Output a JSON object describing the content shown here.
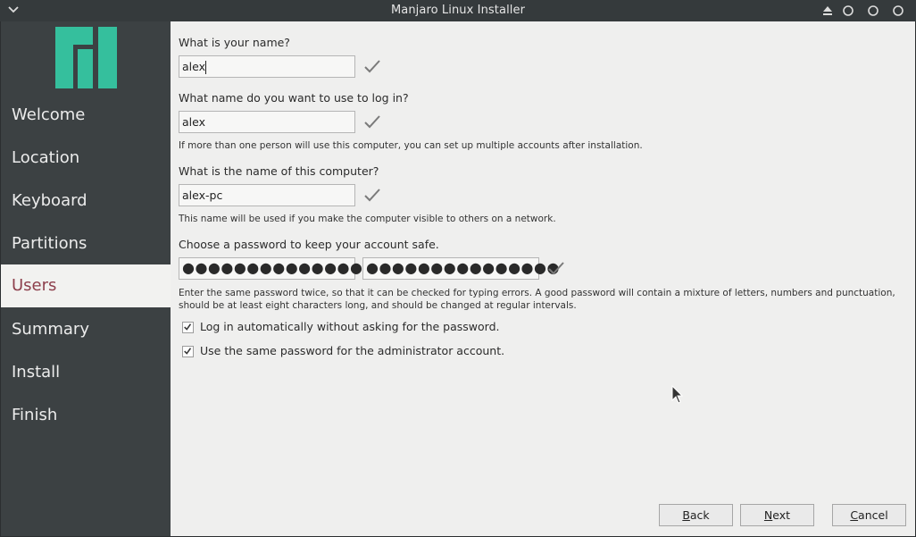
{
  "window": {
    "title": "Manjaro Linux Installer"
  },
  "sidebar": {
    "items": [
      {
        "label": "Welcome"
      },
      {
        "label": "Location"
      },
      {
        "label": "Keyboard"
      },
      {
        "label": "Partitions"
      },
      {
        "label": "Users"
      },
      {
        "label": "Summary"
      },
      {
        "label": "Install"
      },
      {
        "label": "Finish"
      }
    ],
    "active": "Users",
    "logo_color": "#35bf9d"
  },
  "form": {
    "name_label": "What is your name?",
    "name_value": "alex",
    "login_label": "What name do you want to use to log in?",
    "login_value": "alex",
    "login_hint": "If more than one person will use this computer, you can set up multiple accounts after installation.",
    "computer_label": "What is the name of this computer?",
    "computer_value": "alex-pc",
    "computer_hint": "This name will be used if you make the computer visible to others on a network.",
    "password_label": "Choose a password to keep your account safe.",
    "password_mask": "●●●●●●●●●●●●●●●",
    "password_confirm_mask": "●●●●●●●●●●●●●●●",
    "password_hint": "Enter the same password twice, so that it can be checked for typing errors. A good password will contain a mixture of letters, numbers and punctuation, should be at least eight characters long, and should be changed at regular intervals.",
    "autologin_label": "Log in automatically without asking for the password.",
    "autologin_checked": true,
    "same_admin_label": "Use the same password for the administrator account.",
    "same_admin_checked": true
  },
  "buttons": {
    "back": {
      "mnemonic": "B",
      "rest": "ack"
    },
    "next": {
      "mnemonic": "N",
      "rest": "ext"
    },
    "cancel": {
      "mnemonic": "C",
      "rest": "ancel"
    }
  },
  "colors": {
    "accent_active": "#8d3f4c",
    "sidebar_bg": "#3c4143",
    "content_bg": "#efefee",
    "logo": "#35bf9d"
  }
}
